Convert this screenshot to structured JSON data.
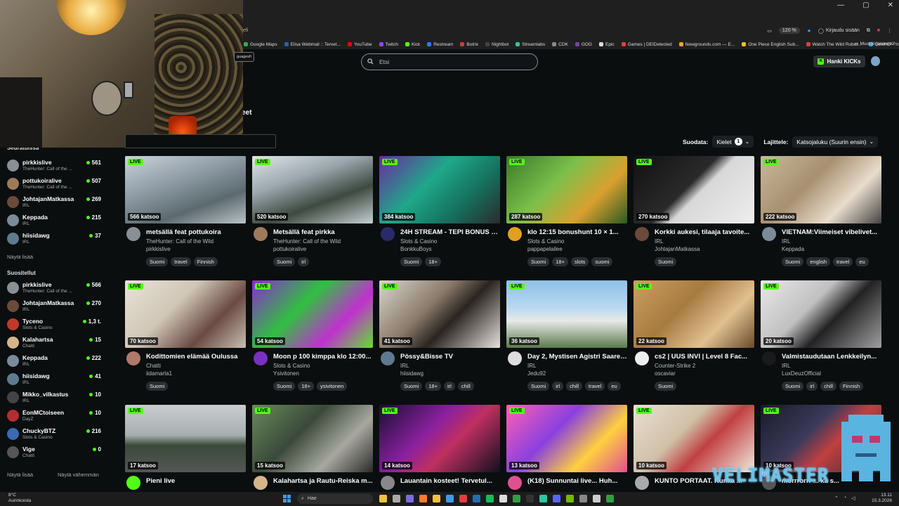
{
  "browser": {
    "addr_fragment": "efi",
    "zoom": "120 %",
    "signin": "Kirjaudu sisään",
    "bookmarks": [
      {
        "label": "Google Maps",
        "color": "#34a853"
      },
      {
        "label": "Elisa Webmail :: Tervet...",
        "color": "#2b5fb3"
      },
      {
        "label": "YouTube",
        "color": "#ff0000"
      },
      {
        "label": "Twitch",
        "color": "#9146ff"
      },
      {
        "label": "Kick",
        "color": "#53fc18"
      },
      {
        "label": "Restream",
        "color": "#2d7cf6"
      },
      {
        "label": "Botrix",
        "color": "#cf3b3b"
      },
      {
        "label": "Nightbot",
        "color": "#444444"
      },
      {
        "label": "Streamlabs",
        "color": "#31c3a2"
      },
      {
        "label": "CDK",
        "color": "#888888"
      },
      {
        "label": "GOG",
        "color": "#7b3fb0"
      },
      {
        "label": "Epic",
        "color": "#dddddd"
      },
      {
        "label": "Games | DEIDetected",
        "color": "#e04040"
      },
      {
        "label": "Newgrounds.com — E...",
        "color": "#f5a623"
      },
      {
        "label": "One Piece English Sub...",
        "color": "#f0c030"
      },
      {
        "label": "Watch The Wild Robot...",
        "color": "#d94040"
      },
      {
        "label": "CineHD - Your Ultimat...",
        "color": "#2fa8e0"
      }
    ],
    "bookmarks_more": "Muut kirjanmerkit"
  },
  "webcam_chip": "guagesfi",
  "search": {
    "placeholder": "Etsi"
  },
  "header": {
    "kicks_button": "Hanki KICKs",
    "heading_fragment": "eet"
  },
  "filters": {
    "filter_label": "Suodata:",
    "languages_label": "Kielet",
    "languages_count": "1",
    "sort_label": "Lajittele:",
    "sort_value": "Katsojaluku (Suurin ensin)"
  },
  "sidebar": {
    "following_title": "Seuratuissa",
    "following": [
      {
        "name": "pirkkislive",
        "category": "TheHunter: Call of the ...",
        "viewers": "561",
        "color": "#8a8f96"
      },
      {
        "name": "pottukoiralive",
        "category": "TheHunter: Call of the ...",
        "viewers": "507",
        "color": "#9c7b5a"
      },
      {
        "name": "JohtajanMatkassa",
        "category": "IRL",
        "viewers": "269",
        "color": "#6a4a3a"
      },
      {
        "name": "Keppada",
        "category": "IRL",
        "viewers": "215",
        "color": "#7b8b9b"
      },
      {
        "name": "hiisidawg",
        "category": "IRL",
        "viewers": "37",
        "color": "#5f7a8f"
      }
    ],
    "show_more": "Näytä lisää",
    "recommended_title": "Suositellut",
    "recommended": [
      {
        "name": "pirkkislive",
        "category": "TheHunter: Call of the ...",
        "viewers": "566",
        "color": "#8a8f96"
      },
      {
        "name": "JohtajanMatkassa",
        "category": "IRL",
        "viewers": "270",
        "color": "#6a4a3a"
      },
      {
        "name": "Tyceno",
        "category": "Slots & Casino",
        "viewers": "1,3 t.",
        "color": "#c0392b"
      },
      {
        "name": "Kalahartsa",
        "category": "Chatti",
        "viewers": "15",
        "color": "#d6b58a"
      },
      {
        "name": "Keppada",
        "category": "IRL",
        "viewers": "222",
        "color": "#7b8b9b"
      },
      {
        "name": "hiisidawg",
        "category": "IRL",
        "viewers": "41",
        "color": "#5f7a8f"
      },
      {
        "name": "Mikko_vilkastus",
        "category": "IRL",
        "viewers": "10",
        "color": "#444444"
      },
      {
        "name": "EonMCtoiseen",
        "category": "DayZ",
        "viewers": "10",
        "color": "#b03030"
      },
      {
        "name": "ChuckyBTZ",
        "category": "Slots & Casino",
        "viewers": "216",
        "color": "#3a6ab0"
      },
      {
        "name": "Vige",
        "category": "Chatti",
        "viewers": "0",
        "color": "#555555"
      }
    ],
    "show_more_2": "Näytä lisää",
    "show_less": "Näytä vähemmän"
  },
  "live_label": "LIVE",
  "streams": [
    {
      "viewers": "566 katsoo",
      "title": "metsällä feat pottukoira",
      "category": "TheHunter: Call of the Wild",
      "user": "pirkkislive",
      "tags": [
        "Suomi",
        "travel",
        "Finnish"
      ],
      "thumb": "linear-gradient(160deg,#c9d3db 0%,#8c99a3 40%,#5c6a70 70%,#b9c3c7 100%)",
      "avatar": "#8a8f96"
    },
    {
      "viewers": "520 katsoo",
      "title": "Metsällä feat pirkka",
      "category": "TheHunter: Call of the Wild",
      "user": "pottukoiralive",
      "tags": [
        "Suomi",
        "irl"
      ],
      "thumb": "linear-gradient(160deg,#dfe6ea 0%,#9aa6ad 35%,#3d4a40 65%,#c8d0d3 100%)",
      "avatar": "#9c7b5a"
    },
    {
      "viewers": "384 katsoo",
      "title": "24H STREAM - TEPI BONUS H...",
      "category": "Slots & Casino",
      "user": "BonkkuBoys",
      "tags": [
        "Suomi",
        "18+"
      ],
      "thumb": "linear-gradient(135deg,#6b2aa0 0%,#1fa88a 40%,#15705e 70%,#2b2b2b 100%)",
      "avatar": "#2a2a6a"
    },
    {
      "viewers": "287 katsoo",
      "title": "klo 12:15 bonushunt 10 × 1...",
      "category": "Slots & Casino",
      "user": "pappapelailee",
      "tags": [
        "Suomi",
        "18+",
        "slots",
        "suomi"
      ],
      "thumb": "linear-gradient(135deg,#3a7a2a 0%,#7cc04a 40%,#d9a030 70%,#2b5a20 100%)",
      "avatar": "#e0a020"
    },
    {
      "viewers": "270 katsoo",
      "title": "Korkki aukesi, tilaaja tavoite...",
      "category": "IRL",
      "user": "JohtajanMatkassa",
      "tags": [
        "Suomi"
      ],
      "thumb": "linear-gradient(135deg,#111 0%,#2a2a2a 45%,#d8d8d8 55%,#eee 100%)",
      "avatar": "#6a4a3a"
    },
    {
      "viewers": "222 katsoo",
      "title": "VIETNAM:Viimeiset vibelivet...",
      "category": "IRL",
      "user": "Keppada",
      "tags": [
        "Suomi",
        "english",
        "travel",
        "eu"
      ],
      "thumb": "linear-gradient(135deg,#c8b89a 0%,#a89070 40%,#e8dccb 70%,#444 100%)",
      "avatar": "#7b8b9b"
    },
    {
      "viewers": "70 katsoo",
      "title": "Kodittomien elämää Oulussa",
      "category": "Chatti",
      "user": "iidamarla1",
      "tags": [
        "Suomi"
      ],
      "thumb": "linear-gradient(135deg,#e8e2d8 0%,#d0c6b6 40%,#6a4a44 70%,#c9bfb0 100%)",
      "avatar": "#b07a6a"
    },
    {
      "viewers": "54 katsoo",
      "title": "Moon p 100 kimppa klo 12:00...",
      "category": "Slots & Casino",
      "user": "Ysivitonen",
      "tags": [
        "Suomi",
        "18+",
        "ysivitonen"
      ],
      "thumb": "linear-gradient(135deg,#8a2bd0 0%,#30c040 40%,#c030d0 70%,#60e030 100%)",
      "avatar": "#7a30c0"
    },
    {
      "viewers": "41 katsoo",
      "title": "Pössy&Bisse TV",
      "category": "IRL",
      "user": "hiisidawg",
      "tags": [
        "Suomi",
        "18+",
        "irl",
        "chill"
      ],
      "thumb": "linear-gradient(135deg,#d9d6d0 0%,#8a7a6a 40%,#2a2420 60%,#e6e2dc 100%)",
      "avatar": "#5f7a8f"
    },
    {
      "viewers": "36 katsoo",
      "title": "Day 2, Mystisen Agistri Saaren...",
      "category": "IRL",
      "user": "Jedu92",
      "tags": [
        "Suomi",
        "irl",
        "chill",
        "travel",
        "eu"
      ],
      "thumb": "linear-gradient(180deg,#8fc0e8 0%,#b8d8f0 40%,#e8e8e8 60%,#5a7a4a 100%)",
      "avatar": "#ddd"
    },
    {
      "viewers": "22 katsoo",
      "title": "cs2 | UUS INVI | Level 8 Fac...",
      "category": "Counter-Strike 2",
      "user": "oscaviar",
      "tags": [
        "Suomi"
      ],
      "thumb": "linear-gradient(135deg,#caa060 0%,#a87a40 40%,#e0c090 70%,#6a4a2a 100%)",
      "avatar": "#eee"
    },
    {
      "viewers": "20 katsoo",
      "title": "Valmistaudutaan Lenkkeilyn...",
      "category": "IRL",
      "user": "LuxDeuzOfficial",
      "tags": [
        "Suomi",
        "irl",
        "chill",
        "Finnish"
      ],
      "thumb": "linear-gradient(135deg,#e8e8e8 0%,#c0c0c0 40%,#222 60%,#a0a0a0 100%)",
      "avatar": "#1a1a1a"
    },
    {
      "viewers": "17 katsoo",
      "title": "Pieni live",
      "category": "",
      "user": "",
      "tags": [],
      "thumb": "linear-gradient(180deg,#c8ccce 0%,#a8aeb0 45%,#3a4a3a 60%,#555 100%)",
      "avatar": "#53fc18"
    },
    {
      "viewers": "15 katsoo",
      "title": "Kalahartsa ja Rautu-Reiska m...",
      "category": "",
      "user": "",
      "tags": [],
      "thumb": "linear-gradient(135deg,#6a8a5a 0%,#3a4a3a 40%,#a8a8a0 70%,#2a2a2a 100%)",
      "avatar": "#d6b58a"
    },
    {
      "viewers": "14 katsoo",
      "title": "Lauantain kosteet! Tervetul...",
      "category": "",
      "user": "",
      "tags": [],
      "thumb": "linear-gradient(135deg,#1a1030 0%,#8a20a0 40%,#c03060 60%,#101020 100%)",
      "avatar": "#888"
    },
    {
      "viewers": "13 katsoo",
      "title": "(K18) Sunnuntai live... Huh...",
      "category": "",
      "user": "",
      "tags": [],
      "thumb": "linear-gradient(135deg,#ff60b0 0%,#8a40e0 40%,#ffd040 70%,#e05090 100%)",
      "avatar": "#e05090"
    },
    {
      "viewers": "10 katsoo",
      "title": "KUNTO PORTAAT. Kunka ...",
      "category": "",
      "user": "",
      "tags": [],
      "thumb": "linear-gradient(135deg,#e8e0d0 0%,#d0c0a8 40%,#c04040 60%,#f0eae0 100%)",
      "avatar": "#aaa"
    },
    {
      "viewers": "10 katsoo",
      "title": "morrrorrr ... ka s...",
      "category": "",
      "user": "",
      "tags": [],
      "thumb": "linear-gradient(135deg,#1a1a2a 0%,#3a3a5a 40%,#c04040 60%,#2a2a3a 100%)",
      "avatar": "#555"
    }
  ],
  "overlay_logo": "VELIMASTER",
  "taskbar": {
    "weather_temp": "8°C",
    "weather_desc": "Aurinkoista",
    "search_text": "Hae",
    "time": "13.11",
    "date": "15.3.2026"
  }
}
